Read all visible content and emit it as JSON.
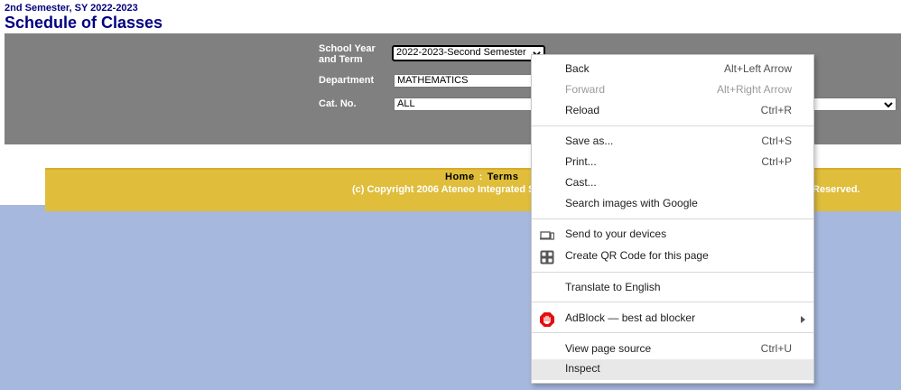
{
  "header": {
    "semester": "2nd Semester, SY 2022-2023",
    "title": "Schedule of Classes"
  },
  "form": {
    "school_year_label_1": "School Year",
    "school_year_label_2": "and Term",
    "school_year_value": "2022-2023-Second Semester",
    "department_label": "Department",
    "department_value": "MATHEMATICS",
    "cat_label": "Cat. No.",
    "cat_value": "ALL"
  },
  "footer": {
    "home": "Home",
    "sep": ":",
    "terms": "Terms",
    "copyright": "(c) Copyright 2006 Ateneo Integrated Stu",
    "copyright_end": "Reserved."
  },
  "context_menu": {
    "back": "Back",
    "back_sc": "Alt+Left Arrow",
    "forward": "Forward",
    "forward_sc": "Alt+Right Arrow",
    "reload": "Reload",
    "reload_sc": "Ctrl+R",
    "save_as": "Save as...",
    "save_as_sc": "Ctrl+S",
    "print": "Print...",
    "print_sc": "Ctrl+P",
    "cast": "Cast...",
    "search_images": "Search images with Google",
    "send_devices": "Send to your devices",
    "qr_code": "Create QR Code for this page",
    "translate": "Translate to English",
    "adblock": "AdBlock — best ad blocker",
    "view_source": "View page source",
    "view_source_sc": "Ctrl+U",
    "inspect": "Inspect"
  },
  "colors": {
    "title_navy": "#000080",
    "panel_gray": "#808080",
    "band_yellow": "#e0bd3b",
    "background_blue": "#a6b8de",
    "adblock_red": "#e40d0d"
  }
}
